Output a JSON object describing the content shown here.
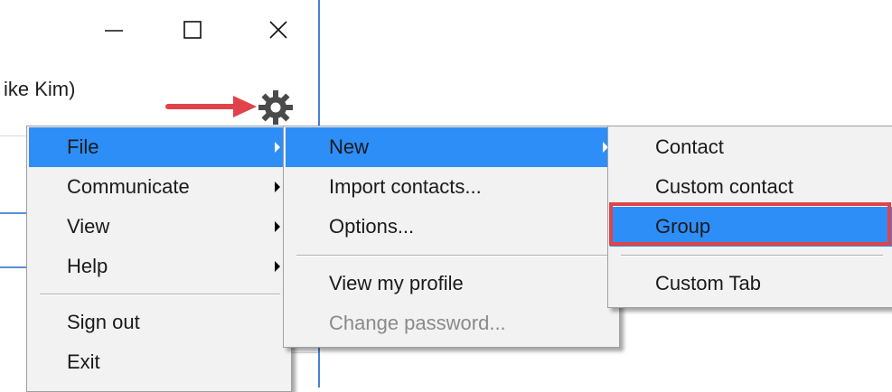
{
  "window": {
    "user_label": "ike Kim)",
    "buttons": {
      "minimize": "minimize-icon",
      "maximize": "maximize-icon",
      "close": "close-icon"
    },
    "gear_icon": "gear-icon"
  },
  "colors": {
    "highlight": "#2e8ef7",
    "arrow": "#e0434a",
    "callout_border": "#e0434a"
  },
  "menu_main": {
    "items": [
      {
        "label": "File",
        "submenu": true,
        "highlighted": true
      },
      {
        "label": "Communicate",
        "submenu": true
      },
      {
        "label": "View",
        "submenu": true
      },
      {
        "label": "Help",
        "submenu": true
      },
      {
        "label": "Sign out"
      },
      {
        "label": "Exit"
      }
    ]
  },
  "menu_file": {
    "items": [
      {
        "label": "New",
        "submenu": true,
        "highlighted": true
      },
      {
        "label": "Import contacts..."
      },
      {
        "label": "Options..."
      },
      {
        "label": "View my profile"
      },
      {
        "label": "Change password...",
        "disabled": true
      }
    ]
  },
  "menu_new": {
    "items": [
      {
        "label": "Contact"
      },
      {
        "label": "Custom contact"
      },
      {
        "label": "Group",
        "highlighted": true
      },
      {
        "label": "Custom Tab"
      }
    ]
  }
}
